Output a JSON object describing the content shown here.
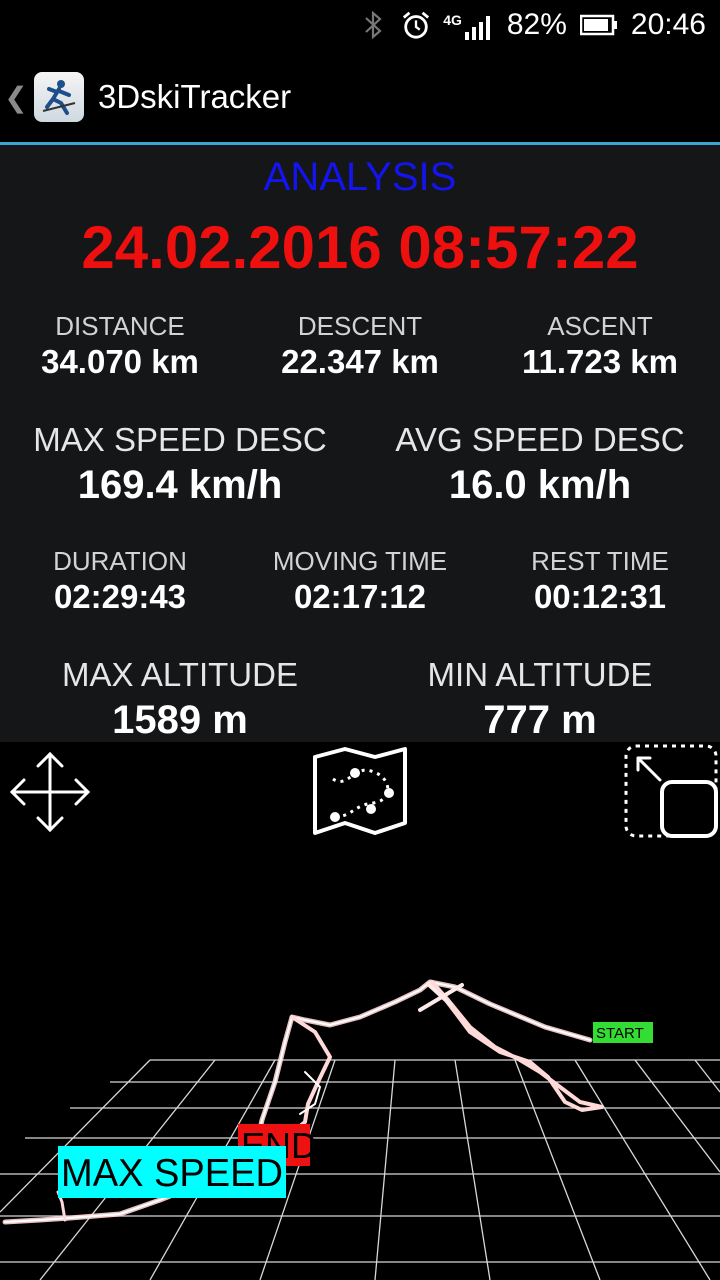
{
  "status_bar": {
    "battery_percent": "82%",
    "time": "20:46",
    "network_type": "4G",
    "icons": [
      "bluetooth-icon",
      "alarm-icon",
      "signal-icon",
      "battery-icon"
    ]
  },
  "action_bar": {
    "back_glyph": "❮",
    "app_title": "3DskiTracker"
  },
  "analysis": {
    "title": "ANALYSIS",
    "datetime": "24.02.2016 08:57:22",
    "stats": {
      "distance": {
        "label": "DISTANCE",
        "value": "34.070 km"
      },
      "descent": {
        "label": "DESCENT",
        "value": "22.347 km"
      },
      "ascent": {
        "label": "ASCENT",
        "value": "11.723 km"
      },
      "max_speed_desc": {
        "label": "MAX SPEED DESC",
        "value": "169.4 km/h"
      },
      "avg_speed_desc": {
        "label": "AVG SPEED DESC",
        "value": "16.0 km/h"
      },
      "duration": {
        "label": "DURATION",
        "value": "02:29:43"
      },
      "moving_time": {
        "label": "MOVING TIME",
        "value": "02:17:12"
      },
      "rest_time": {
        "label": "REST TIME",
        "value": "00:12:31"
      },
      "max_altitude": {
        "label": "MAX ALTITUDE",
        "value": "1589 m"
      },
      "min_altitude": {
        "label": "MIN ALTITUDE",
        "value": "777 m"
      }
    },
    "colors": {
      "title": "#1414ee",
      "datetime": "#ee0f0f",
      "panel_bg": "#141618",
      "accent": "#3aa6d6"
    }
  },
  "view3d": {
    "tools": [
      "move-arrows-icon",
      "map-route-icon",
      "resize-icon"
    ],
    "markers": {
      "start": {
        "label": "START",
        "color": "#33dd33"
      },
      "end": {
        "label": "END",
        "color": "#ee1111"
      },
      "max_speed": {
        "label": "MAX SPEED",
        "color": "#00ffff"
      }
    }
  }
}
